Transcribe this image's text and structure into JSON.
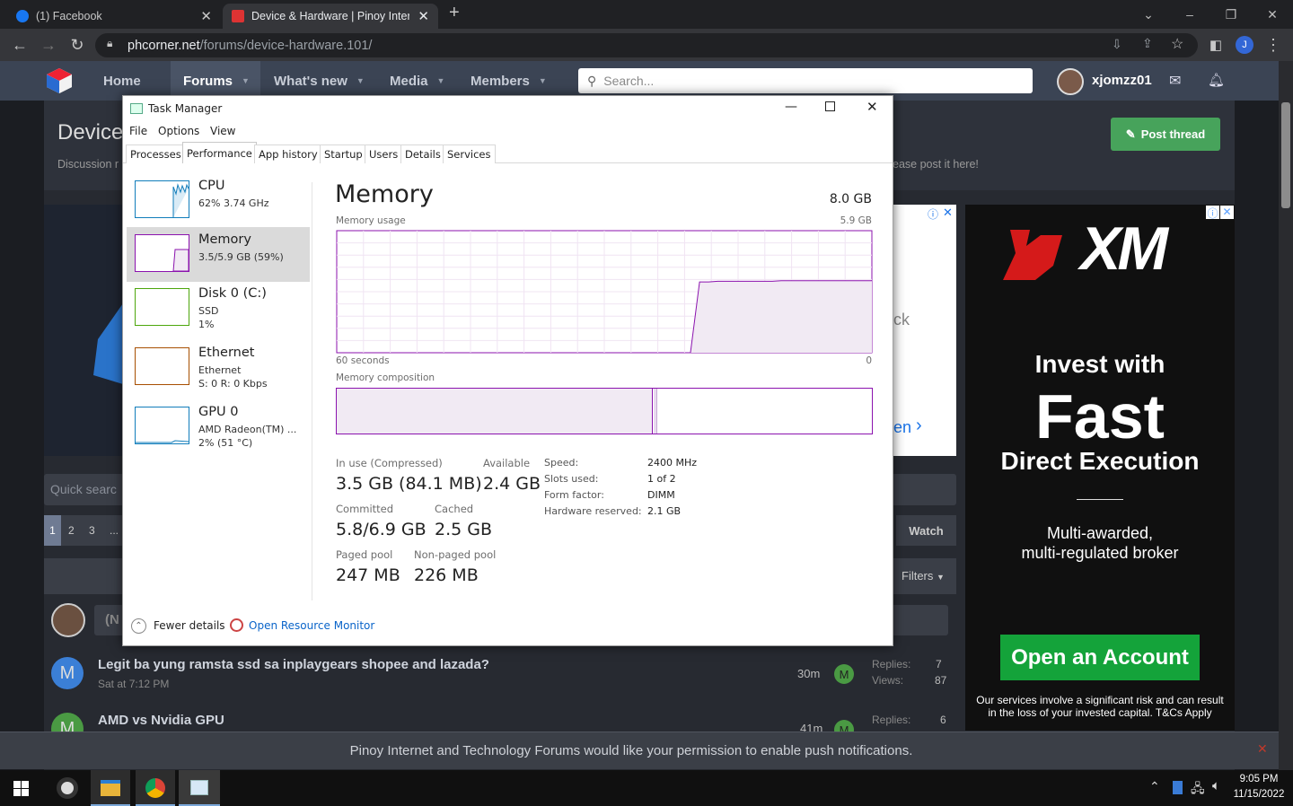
{
  "browser": {
    "tabs": [
      {
        "title": "(1) Facebook"
      },
      {
        "title": "Device & Hardware | Pinoy Intern"
      }
    ],
    "url_domain": "phcorner.net",
    "url_path": "/forums/device-hardware.101/",
    "profile_initial": "J"
  },
  "site": {
    "nav": [
      "Home",
      "Forums",
      "What's new",
      "Media",
      "Members"
    ],
    "search_placeholder": "Search...",
    "username": "xjomzz01",
    "title_partial": "Device",
    "subtitle_partial": "Discussion r",
    "subtitle_tail": "ease post it here!",
    "post_button": "Post thread",
    "quick_search": "Quick searc",
    "pages": [
      "1",
      "2",
      "3",
      "..."
    ],
    "watch": "Watch",
    "filters": "Filters",
    "avatar_partial": "(N",
    "threads": [
      {
        "avatar": "M",
        "title": "Legit ba yung ramsta ssd sa inplaygears shopee and lazada?",
        "meta": "Sat at 7:12 PM",
        "age": "30m",
        "last": "M",
        "replies_label": "Replies:",
        "replies": "7",
        "views_label": "Views:",
        "views": "87"
      },
      {
        "avatar": "M",
        "title": "AMD vs Nvidia GPU",
        "age": "41m",
        "last": "M",
        "replies_label": "Replies:",
        "replies": "6"
      }
    ],
    "ad_left_fragments": [
      "ck",
      "en"
    ],
    "notification": "Pinoy Internet and Technology Forums would like your permission to enable push notifications.",
    "ad": {
      "brand": "XM",
      "line1": "Invest with",
      "line2": "Fast",
      "line3": "Direct Execution",
      "line4": "Multi-awarded,",
      "line5": "multi-regulated broker",
      "cta": "Open an Account",
      "disclaimer": "Our services involve a significant risk and can result in the loss of your invested capital. T&Cs Apply"
    }
  },
  "taskmanager": {
    "title": "Task Manager",
    "menu": [
      "File",
      "Options",
      "View"
    ],
    "tabs": [
      "Processes",
      "Performance",
      "App history",
      "Startup",
      "Users",
      "Details",
      "Services"
    ],
    "sidebar": [
      {
        "name": "CPU",
        "line1": "62% 3.74 GHz",
        "line2": ""
      },
      {
        "name": "Memory",
        "line1": "3.5/5.9 GB (59%)",
        "line2": ""
      },
      {
        "name": "Disk 0 (C:)",
        "line1": "SSD",
        "line2": "1%"
      },
      {
        "name": "Ethernet",
        "line1": "Ethernet",
        "line2": "S: 0 R: 0 Kbps"
      },
      {
        "name": "GPU 0",
        "line1": "AMD Radeon(TM) ...",
        "line2": "2% (51 °C)"
      }
    ],
    "heading": "Memory",
    "total": "8.0 GB",
    "usage_label": "Memory usage",
    "usage_max": "5.9 GB",
    "time_label": "60 seconds",
    "time_end": "0",
    "composition_label": "Memory composition",
    "stats": [
      {
        "label": "In use (Compressed)",
        "value": "3.5 GB (84.1 MB)"
      },
      {
        "label": "Available",
        "value": "2.4 GB"
      },
      {
        "label": "Committed",
        "value": "5.8/6.9 GB"
      },
      {
        "label": "Cached",
        "value": "2.5 GB"
      },
      {
        "label": "Paged pool",
        "value": "247 MB"
      },
      {
        "label": "Non-paged pool",
        "value": "226 MB"
      }
    ],
    "specs": [
      {
        "key": "Speed:",
        "val": "2400 MHz"
      },
      {
        "key": "Slots used:",
        "val": "1 of 2"
      },
      {
        "key": "Form factor:",
        "val": "DIMM"
      },
      {
        "key": "Hardware reserved:",
        "val": "2.1 GB"
      }
    ],
    "fewer_details": "Fewer details",
    "resource_monitor": "Open Resource Monitor",
    "memory_usage_fraction": 0.59,
    "memory_history": [
      0,
      0,
      0,
      0,
      0,
      0,
      0,
      0,
      0,
      0,
      0,
      0,
      0,
      0,
      0,
      0,
      0,
      0,
      0,
      0,
      0,
      0,
      0,
      0,
      0,
      0,
      0,
      0,
      0,
      0,
      0,
      0,
      0,
      0,
      0,
      0,
      0,
      0,
      0,
      0,
      0.58,
      0.58,
      0.585,
      0.585,
      0.585,
      0.585,
      0.585,
      0.585,
      0.585,
      0.59,
      0.59,
      0.59,
      0.59,
      0.59,
      0.59,
      0.59,
      0.59,
      0.59,
      0.59,
      0.59
    ]
  },
  "taskbar": {
    "time": "9:05 PM",
    "date": "11/15/2022"
  },
  "colors": {
    "memory": "#8b12ae",
    "memory_fill": "#f1eaf3",
    "cpu": "#117dbb",
    "disk": "#4da60c",
    "ethernet": "#a74f01",
    "gpu": "#117dbb",
    "xm_red": "#d51a1a",
    "xm_cta": "#14a33a"
  }
}
